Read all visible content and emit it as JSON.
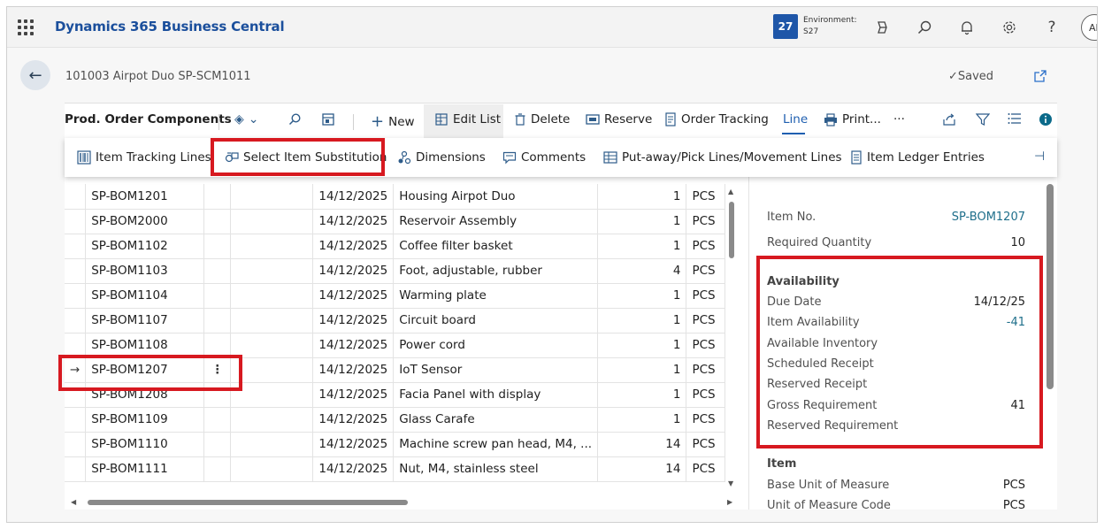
{
  "appbar": {
    "title": "Dynamics 365 Business Central",
    "env_number": "27",
    "env_label": "Environment:",
    "env_name": "S27",
    "avatar": "Al"
  },
  "page": {
    "title": "101003 Airpot Duo SP-SCM1011",
    "saved": "✓Saved"
  },
  "toolbar": {
    "title": "Prod. Order Components",
    "new": "New",
    "edit_list": "Edit List",
    "delete": "Delete",
    "reserve": "Reserve",
    "order_tracking": "Order Tracking",
    "line": "Line",
    "print": "Print...",
    "more": "···"
  },
  "subbar": {
    "item_tracking": "Item Tracking Lines",
    "select_substitution": "Select Item Substitution",
    "dimensions": "Dimensions",
    "comments": "Comments",
    "putaway": "Put-away/Pick Lines/Movement Lines",
    "ledger": "Item Ledger Entries"
  },
  "rows": [
    {
      "item": "SP-BOM1201",
      "date": "14/12/2025",
      "desc": "Housing Airpot Duo",
      "qty": "1",
      "uom": "PCS"
    },
    {
      "item": "SP-BOM2000",
      "date": "14/12/2025",
      "desc": "Reservoir Assembly",
      "qty": "1",
      "uom": "PCS"
    },
    {
      "item": "SP-BOM1102",
      "date": "14/12/2025",
      "desc": "Coffee filter basket",
      "qty": "1",
      "uom": "PCS"
    },
    {
      "item": "SP-BOM1103",
      "date": "14/12/2025",
      "desc": "Foot, adjustable, rubber",
      "qty": "4",
      "uom": "PCS"
    },
    {
      "item": "SP-BOM1104",
      "date": "14/12/2025",
      "desc": "Warming plate",
      "qty": "1",
      "uom": "PCS"
    },
    {
      "item": "SP-BOM1107",
      "date": "14/12/2025",
      "desc": "Circuit board",
      "qty": "1",
      "uom": "PCS"
    },
    {
      "item": "SP-BOM1108",
      "date": "14/12/2025",
      "desc": "Power cord",
      "qty": "1",
      "uom": "PCS"
    },
    {
      "item": "SP-BOM1207",
      "date": "14/12/2025",
      "desc": "IoT Sensor",
      "qty": "1",
      "uom": "PCS",
      "selected": true
    },
    {
      "item": "SP-BOM1208",
      "date": "14/12/2025",
      "desc": "Facia Panel with display",
      "qty": "1",
      "uom": "PCS"
    },
    {
      "item": "SP-BOM1109",
      "date": "14/12/2025",
      "desc": "Glass Carafe",
      "qty": "1",
      "uom": "PCS"
    },
    {
      "item": "SP-BOM1110",
      "date": "14/12/2025",
      "desc": "Machine screw pan head, M4, ...",
      "qty": "14",
      "uom": "PCS"
    },
    {
      "item": "SP-BOM1111",
      "date": "14/12/2025",
      "desc": "Nut, M4, stainless steel",
      "qty": "14",
      "uom": "PCS"
    }
  ],
  "factbox": {
    "item_no_label": "Item No.",
    "item_no": "SP-BOM1207",
    "req_qty_label": "Required Quantity",
    "req_qty": "10",
    "availability_heading": "Availability",
    "due_date_label": "Due Date",
    "due_date": "14/12/25",
    "item_avail_label": "Item Availability",
    "item_avail": "-41",
    "avail_inv_label": "Available Inventory",
    "sched_receipt_label": "Scheduled Receipt",
    "res_receipt_label": "Reserved Receipt",
    "gross_req_label": "Gross Requirement",
    "gross_req": "41",
    "res_req_label": "Reserved Requirement",
    "item_heading": "Item",
    "base_uom_label": "Base Unit of Measure",
    "base_uom": "PCS",
    "uom_code_label": "Unit of Measure Code",
    "uom_code": "PCS"
  },
  "colors": {
    "brand": "#1b4f9c",
    "highlight": "#d71920",
    "selected_cell": "#b5e6ef",
    "link": "#1f6f8b"
  }
}
